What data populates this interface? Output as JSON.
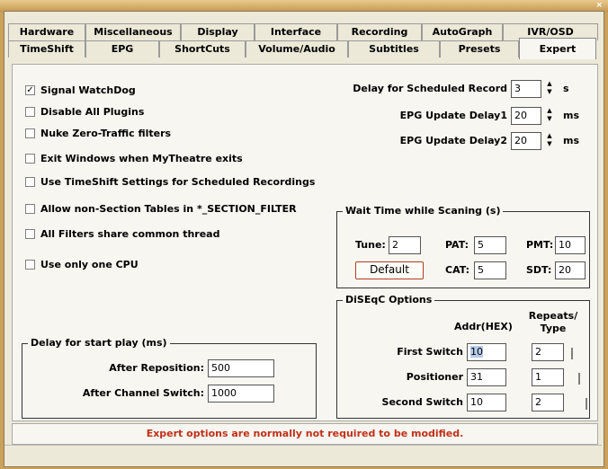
{
  "tabs_row1": [
    "Hardware",
    "Miscellaneous",
    "Display",
    "Interface",
    "Recording",
    "AutoGraph",
    "IVR/OSD"
  ],
  "tabs_row2": [
    "TimeShift",
    "EPG",
    "ShortCuts",
    "Volume/Audio",
    "Subtitles",
    "Presets",
    "Expert"
  ],
  "active_tab": "Expert",
  "checkboxes": [
    {
      "label": "Signal WatchDog",
      "checked": true
    },
    {
      "label": "Disable All Plugins",
      "checked": false
    },
    {
      "label": "Nuke Zero-Traffic filters",
      "checked": false
    },
    {
      "label": "Exit Windows when MyTheatre exits",
      "checked": false
    },
    {
      "label": "Use TimeShift Settings for Scheduled Recordings",
      "checked": false
    },
    {
      "label": "Allow non-Section Tables in *_SECTION_FILTER",
      "checked": false
    },
    {
      "label": "All Filters share common thread",
      "checked": false
    },
    {
      "label": "Use only one CPU",
      "checked": false
    }
  ],
  "delays": {
    "scheduled": {
      "label": "Delay for Scheduled Record",
      "value": "3",
      "unit": "s"
    },
    "epg1": {
      "label": "EPG Update Delay1",
      "value": "20",
      "unit": "ms"
    },
    "epg2": {
      "label": "EPG Update Delay2",
      "value": "20",
      "unit": "ms"
    }
  },
  "wait": {
    "title": "Wait Time while Scaning (s)",
    "tune_label": "Tune:",
    "tune": "2",
    "pat_label": "PAT:",
    "pat": "5",
    "pmt_label": "PMT:",
    "pmt": "10",
    "cat_label": "CAT:",
    "cat": "5",
    "sdt_label": "SDT:",
    "sdt": "20",
    "default_button": "Default"
  },
  "diseqc": {
    "title": "DiSEqC Options",
    "addr_header": "Addr(HEX)",
    "repeats_header": "Repeats/ Type",
    "rows": [
      {
        "label": "First Switch",
        "addr": "10",
        "repeats": "2"
      },
      {
        "label": "Positioner",
        "addr": "31",
        "repeats": "1"
      },
      {
        "label": "Second Switch",
        "addr": "10",
        "repeats": "2"
      }
    ]
  },
  "play_delay": {
    "title": "Delay for start play (ms)",
    "reposition_label": "After Reposition:",
    "reposition": "500",
    "channel_label": "After Channel Switch:",
    "channel": "1000"
  },
  "status_text": "Expert options are normally not required to be modified.",
  "close_glyph": "×"
}
